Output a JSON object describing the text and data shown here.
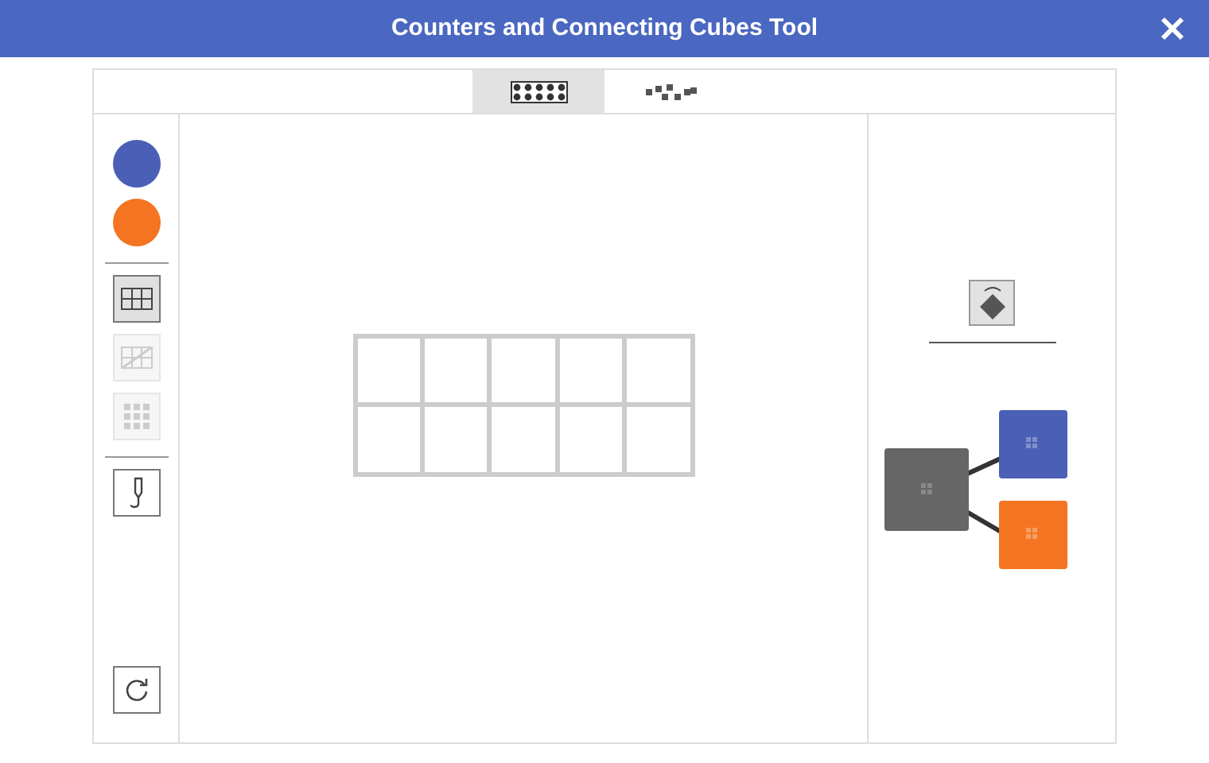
{
  "window": {
    "title": "Counters and Connecting Cubes Tool"
  },
  "tabs": [
    {
      "kind": "frame",
      "selected": true
    },
    {
      "kind": "scatter",
      "selected": false
    }
  ],
  "tools": [
    {
      "kind": "counter",
      "color": "#4a5fb5"
    },
    {
      "kind": "counter",
      "color": "#f47421"
    },
    {
      "kind": "divider"
    },
    {
      "kind": "frame",
      "selected": true,
      "disabled": false
    },
    {
      "kind": "frame-off",
      "selected": false,
      "disabled": true
    },
    {
      "kind": "dots",
      "selected": false,
      "disabled": true
    },
    {
      "kind": "divider"
    },
    {
      "kind": "pen",
      "selected": false,
      "disabled": false
    }
  ],
  "cubes": [
    {
      "color": "#4a5fb5"
    },
    {
      "color": "#f47421"
    }
  ]
}
